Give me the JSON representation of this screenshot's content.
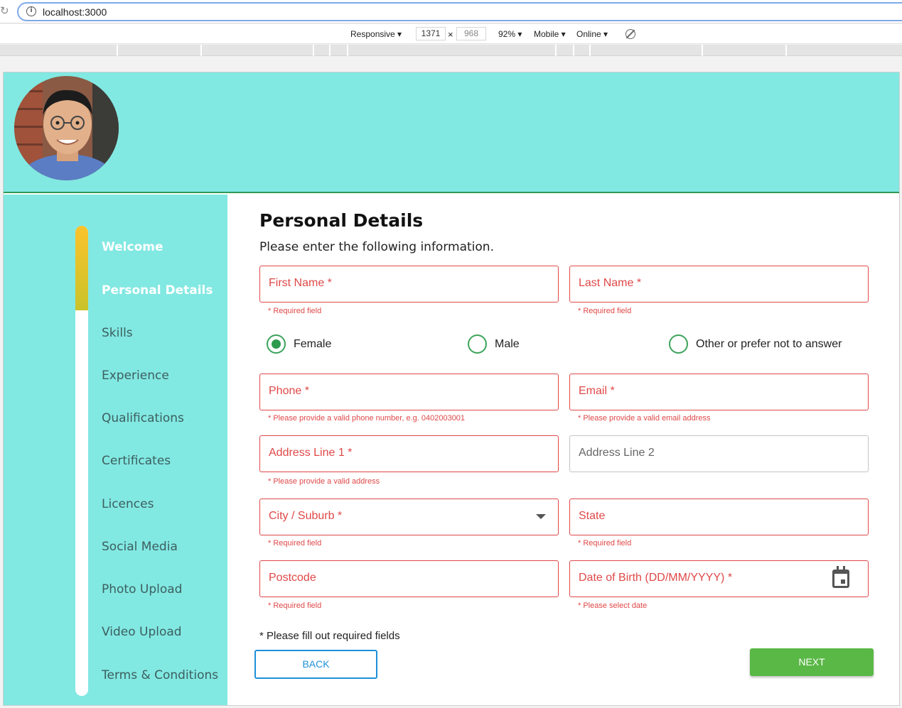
{
  "browser": {
    "url": "localhost:3000",
    "device_mode": "Responsive ▾",
    "width": "1371",
    "height": "968",
    "dimension_separator": "×",
    "zoom": "92% ▾",
    "device_type": "Mobile ▾",
    "throttling": "Online ▾"
  },
  "sidebar": {
    "progress_fraction": 0.18,
    "items": [
      {
        "label": "Welcome",
        "state": "completed"
      },
      {
        "label": "Personal Details",
        "state": "current"
      },
      {
        "label": "Skills",
        "state": "pending"
      },
      {
        "label": "Experience",
        "state": "pending"
      },
      {
        "label": "Qualifications",
        "state": "pending"
      },
      {
        "label": "Certificates",
        "state": "pending"
      },
      {
        "label": "Licences",
        "state": "pending"
      },
      {
        "label": "Social Media",
        "state": "pending"
      },
      {
        "label": "Photo Upload",
        "state": "pending"
      },
      {
        "label": "Video Upload",
        "state": "pending"
      },
      {
        "label": "Terms & Conditions",
        "state": "pending"
      }
    ]
  },
  "form": {
    "title": "Personal Details",
    "intro": "Please enter the following information.",
    "first_name": {
      "label": "First Name *",
      "helper": "* Required field"
    },
    "last_name": {
      "label": "Last Name *",
      "helper": "* Required field"
    },
    "gender": {
      "options": [
        "Female",
        "Male",
        "Other or prefer not to answer"
      ],
      "selected": "Female"
    },
    "phone": {
      "label": "Phone *",
      "helper": "* Please provide a valid phone number, e.g. 0402003001"
    },
    "email": {
      "label": "Email *",
      "helper": "* Please provide a valid email address"
    },
    "address1": {
      "label": "Address Line 1 *",
      "helper": "* Please provide a valid address"
    },
    "address2": {
      "label": "Address Line 2"
    },
    "city": {
      "label": "City / Suburb *",
      "helper": "* Required field"
    },
    "state": {
      "label": "State",
      "helper": "* Required field"
    },
    "postcode": {
      "label": "Postcode",
      "helper": "* Required field"
    },
    "dob": {
      "label": "Date of Birth (DD/MM/YYYY) *",
      "helper": "* Please select date"
    },
    "required_note": "* Please fill out required fields",
    "back_label": "BACK",
    "next_label": "NEXT"
  },
  "colors": {
    "accent_teal": "#82e8e2",
    "error_red": "#e04848",
    "success_green": "#5ab846",
    "link_blue": "#1e90d8",
    "progress_yellow": "#fbc32c"
  }
}
